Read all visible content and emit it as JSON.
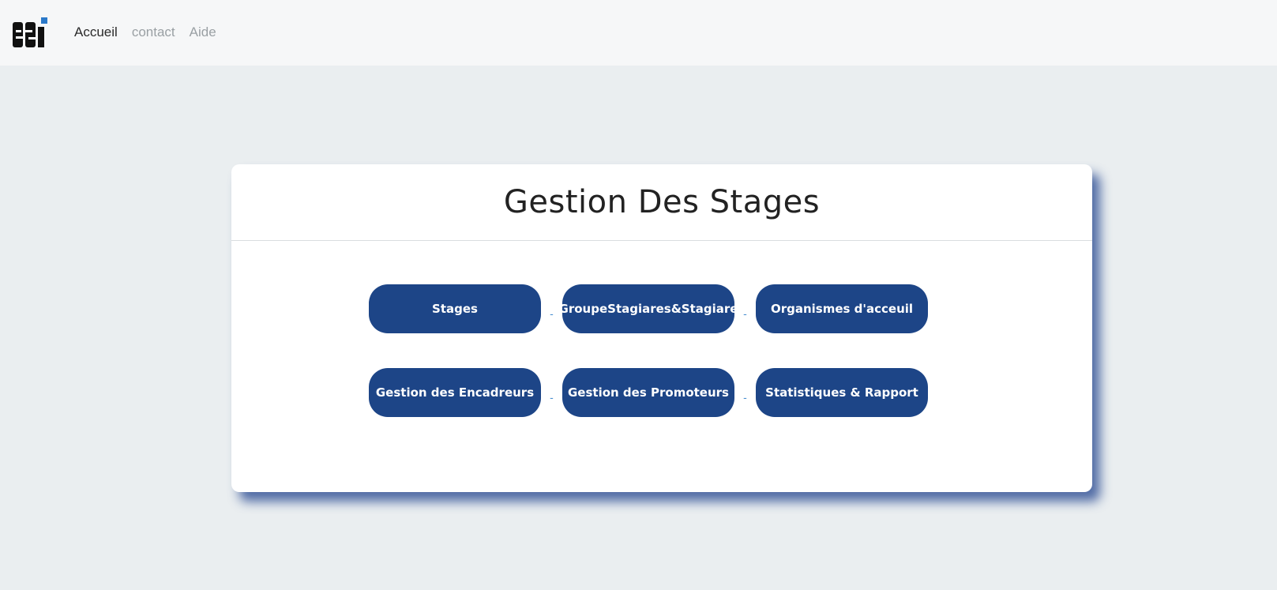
{
  "nav": {
    "logo_text": "esi",
    "links": [
      {
        "label": "Accueil"
      },
      {
        "label": "contact"
      },
      {
        "label": "Aide"
      }
    ]
  },
  "card": {
    "title": "Gestion Des Stages",
    "separator": "-",
    "rows": [
      [
        {
          "label": "Stages"
        },
        {
          "label": "GroupeStagiares&Stagiare"
        },
        {
          "label": "Organismes d'acceuil"
        }
      ],
      [
        {
          "label": "Gestion des Encadreurs"
        },
        {
          "label": "Gestion des Promoteurs"
        },
        {
          "label": "Statistiques & Rapport"
        }
      ]
    ]
  },
  "colors": {
    "button_bg": "#1d4587",
    "page_bg": "#eaeef0",
    "navbar_bg": "#f6f7f8"
  }
}
